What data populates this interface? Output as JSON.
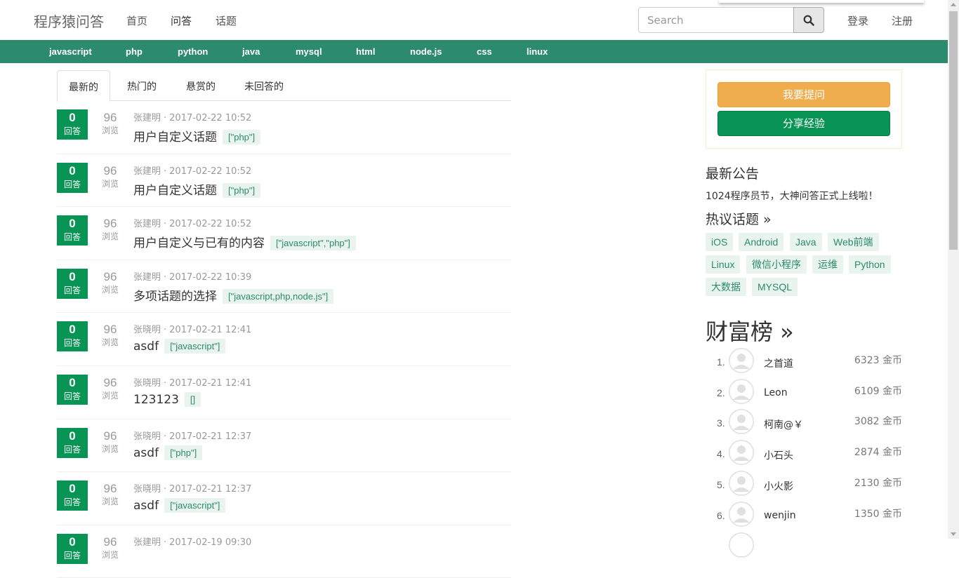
{
  "header": {
    "brand": "程序猿问答",
    "nav": [
      "首页",
      "问答",
      "话题"
    ],
    "search_placeholder": "Search",
    "login": "登录",
    "register": "注册"
  },
  "topics_bar": [
    "javascript",
    "php",
    "python",
    "java",
    "mysql",
    "html",
    "node.js",
    "css",
    "linux"
  ],
  "tabs": [
    "最新的",
    "热门的",
    "悬赏的",
    "未回答的"
  ],
  "questions": [
    {
      "answers": "0",
      "answers_label": "回答",
      "views": "96",
      "views_label": "浏览",
      "author": "张建明",
      "time": "2017-02-22 10:52",
      "title": "用户自定义话题",
      "tag": "[\"php\"]"
    },
    {
      "answers": "0",
      "answers_label": "回答",
      "views": "96",
      "views_label": "浏览",
      "author": "张建明",
      "time": "2017-02-22 10:52",
      "title": "用户自定义话题",
      "tag": "[\"php\"]"
    },
    {
      "answers": "0",
      "answers_label": "回答",
      "views": "96",
      "views_label": "浏览",
      "author": "张建明",
      "time": "2017-02-22 10:52",
      "title": "用户自定义与已有的内容",
      "tag": "[\"javascript\",\"php\"]"
    },
    {
      "answers": "0",
      "answers_label": "回答",
      "views": "96",
      "views_label": "浏览",
      "author": "张建明",
      "time": "2017-02-22 10:39",
      "title": "多项话题的选择",
      "tag": "[\"javascript,php,node.js\"]"
    },
    {
      "answers": "0",
      "answers_label": "回答",
      "views": "96",
      "views_label": "浏览",
      "author": "张晓明",
      "time": "2017-02-21 12:41",
      "title": "asdf",
      "tag": "[\"javascript\"]"
    },
    {
      "answers": "0",
      "answers_label": "回答",
      "views": "96",
      "views_label": "浏览",
      "author": "张晓明",
      "time": "2017-02-21 12:41",
      "title": "123123",
      "tag": "[]"
    },
    {
      "answers": "0",
      "answers_label": "回答",
      "views": "96",
      "views_label": "浏览",
      "author": "张晓明",
      "time": "2017-02-21 12:37",
      "title": "asdf",
      "tag": "[\"php\"]"
    },
    {
      "answers": "0",
      "answers_label": "回答",
      "views": "96",
      "views_label": "浏览",
      "author": "张晓明",
      "time": "2017-02-21 12:37",
      "title": "asdf",
      "tag": "[\"javascript\"]"
    },
    {
      "answers": "0",
      "answers_label": "回答",
      "views": "96",
      "views_label": "浏览",
      "author": "张建明",
      "time": "2017-02-19 09:30",
      "title": "",
      "tag": ""
    }
  ],
  "sidebar": {
    "ask_button": "我要提问",
    "share_button": "分享经验",
    "notice_title": "最新公告",
    "notice_text": "1024程序员节，大神问答正式上线啦！",
    "hot_topics_title": "热议话题 »",
    "hot_topics": [
      "iOS",
      "Android",
      "Java",
      "Web前端",
      "Linux",
      "微信小程序",
      "运维",
      "Python",
      "大数据",
      "MYSQL"
    ],
    "rich_title": "财富榜 »",
    "rich_list": [
      {
        "rank": "1.",
        "name": "之首道",
        "gold": "6323 金币"
      },
      {
        "rank": "2.",
        "name": "Leon",
        "gold": "6109 金币"
      },
      {
        "rank": "3.",
        "name": "柯南@￥",
        "gold": "3082 金币"
      },
      {
        "rank": "4.",
        "name": "小石头",
        "gold": "2874 金币"
      },
      {
        "rank": "5.",
        "name": "小火影",
        "gold": "2130 金币"
      },
      {
        "rank": "6.",
        "name": "wenjin",
        "gold": "1350 金币"
      }
    ]
  },
  "colors": {
    "brand_green": "#2c8a6d",
    "answer_green": "#079454",
    "ask_orange": "#f0ad4e"
  }
}
